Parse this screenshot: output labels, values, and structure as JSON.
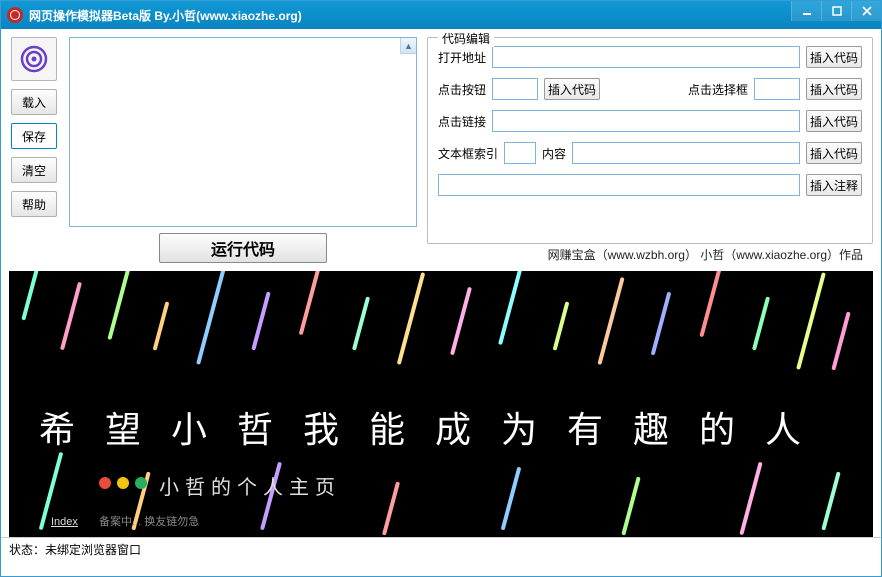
{
  "window": {
    "title": "网页操作模拟器Beta版    By.小哲(www.xiaozhe.org)"
  },
  "left_buttons": {
    "load": "载入",
    "save": "保存",
    "clear": "清空",
    "help": "帮助"
  },
  "run_button": "运行代码",
  "edit_panel": {
    "legend": "代码编辑",
    "open_url_label": "打开地址",
    "click_button_label": "点击按钮",
    "click_select_label": "点击选择框",
    "click_link_label": "点击链接",
    "text_index_label": "文本框索引",
    "content_label": "内容",
    "insert_code": "插入代码",
    "insert_comment": "插入注释"
  },
  "credit": "网赚宝盒（www.wzbh.org） 小哲（www.xiaozhe.org）作品",
  "browser_page": {
    "hero": "希望小哲我能成为有趣的人",
    "subtitle": "小哲的个人主页",
    "index_link": "Index",
    "footer": "备案中... 换友链勿急"
  },
  "status": {
    "label": "状态：",
    "value": "未绑定浏览器窗口"
  }
}
